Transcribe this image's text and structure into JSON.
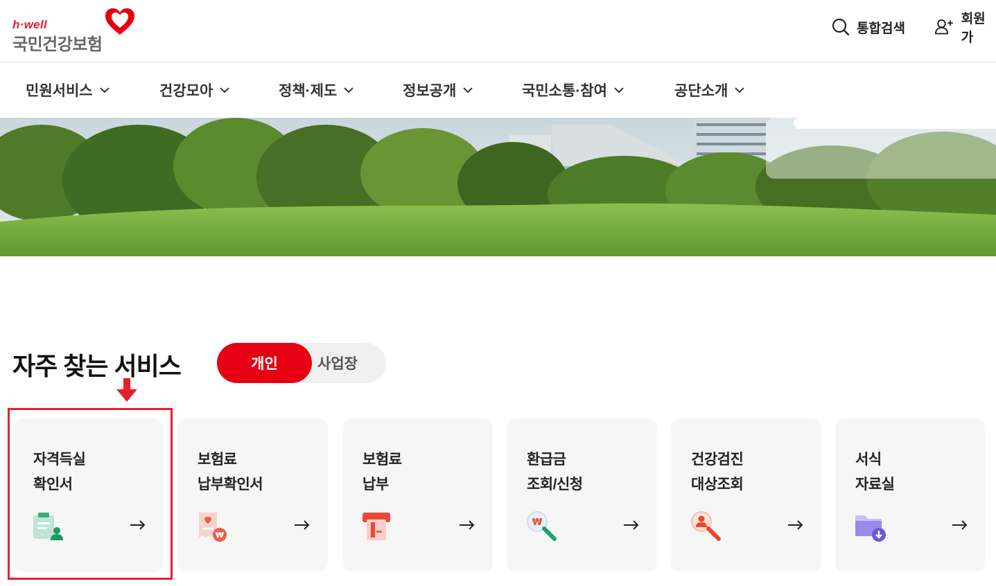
{
  "header": {
    "logo_sub": "h·well",
    "logo_main": "국민건강보험",
    "search_label": "통합검색",
    "join_label": "회원가"
  },
  "gnb": {
    "items": [
      {
        "label": "민원서비스"
      },
      {
        "label": "건강모아"
      },
      {
        "label": "정책·제도"
      },
      {
        "label": "정보공개"
      },
      {
        "label": "국민소통·참여"
      },
      {
        "label": "공단소개"
      }
    ]
  },
  "section": {
    "title": "자주 찾는 서비스",
    "toggle_personal": "개인",
    "toggle_business": "사업장"
  },
  "cards": [
    {
      "line1": "자격득실",
      "line2": "확인서",
      "icon": "certificate-person-icon"
    },
    {
      "line1": "보험료",
      "line2": "납부확인서",
      "icon": "receipt-won-icon"
    },
    {
      "line1": "보험료",
      "line2": "납부",
      "icon": "card-payment-icon"
    },
    {
      "line1": "환급금",
      "line2": "조회/신청",
      "icon": "search-won-icon"
    },
    {
      "line1": "건강검진",
      "line2": "대상조회",
      "icon": "search-person-icon"
    },
    {
      "line1": "서식",
      "line2": "자료실",
      "icon": "folder-download-icon"
    }
  ],
  "colors": {
    "brand_red": "#e60012",
    "marker_red": "#e5202e",
    "card_bg": "#f6f6f6"
  }
}
